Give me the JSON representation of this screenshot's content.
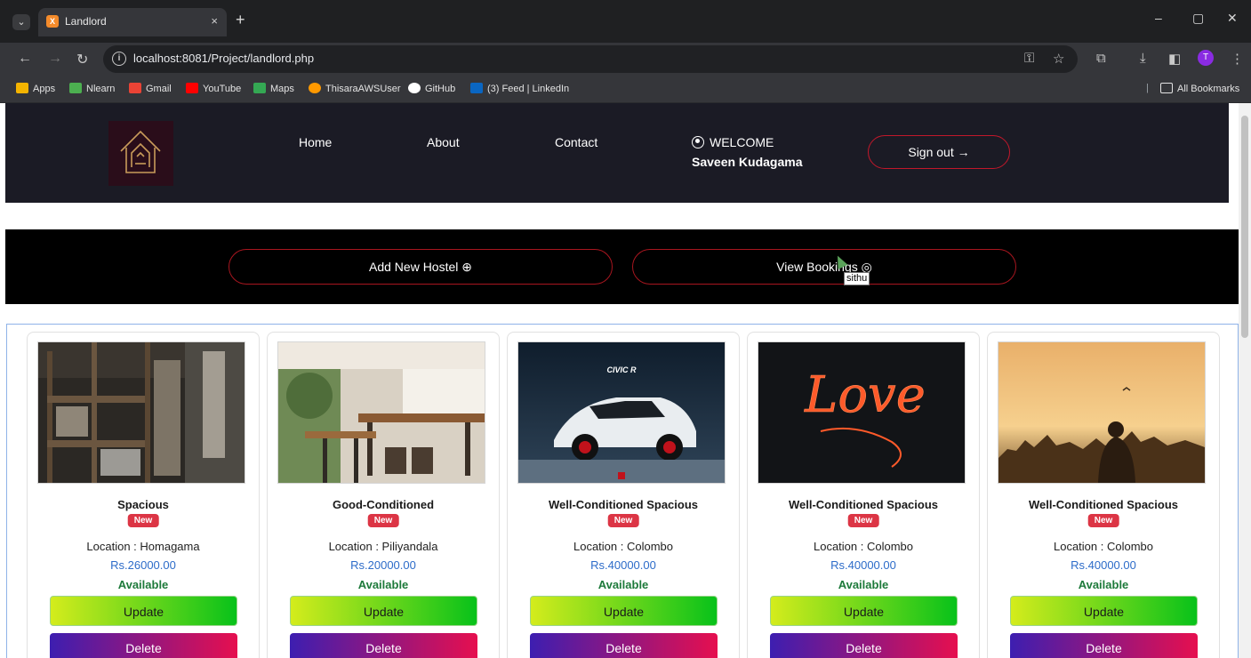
{
  "browser": {
    "tab": {
      "title": "Landlord",
      "close": "×",
      "new_tab": "+"
    },
    "window_controls": {
      "minimize": "–",
      "restore": "▢",
      "close": "✕"
    },
    "url": "localhost:8081/Project/landlord.php",
    "bookmarks": [
      {
        "label": "Apps",
        "icon": "apps-grid-icon",
        "color": "#f4b400"
      },
      {
        "label": "Nlearn",
        "icon": "nlearn-icon",
        "color": "#4caf50"
      },
      {
        "label": "Gmail",
        "icon": "gmail-icon",
        "color": "#ea4335"
      },
      {
        "label": "YouTube",
        "icon": "youtube-icon",
        "color": "#ff0000"
      },
      {
        "label": "Maps",
        "icon": "maps-icon",
        "color": "#34a853"
      },
      {
        "label": "ThisaraAWSUser",
        "icon": "aws-icon",
        "color": "#ff9900"
      },
      {
        "label": "GitHub",
        "icon": "github-icon",
        "color": "#ffffff"
      },
      {
        "label": "(3) Feed | LinkedIn",
        "icon": "linkedin-icon",
        "color": "#0a66c2"
      }
    ],
    "all_bookmarks": "All Bookmarks",
    "profile_initial": "T"
  },
  "header": {
    "nav": [
      "Home",
      "About",
      "Contact"
    ],
    "welcome": "WELCOME",
    "user_name": "Saveen Kudagama",
    "signout": "Sign out →"
  },
  "actions": {
    "add_hostel": "Add New Hostel ⊕",
    "view_bookings": "View Bookings ◎",
    "tooltip": "sithu"
  },
  "cards": [
    {
      "title": "Spacious",
      "badge": "New",
      "location": "Location : Homagama",
      "price": "Rs.26000.00",
      "status": "Available",
      "update": "Update",
      "delete": "Delete"
    },
    {
      "title": "Good-Conditioned",
      "badge": "New",
      "location": "Location : Piliyandala",
      "price": "Rs.20000.00",
      "status": "Available",
      "update": "Update",
      "delete": "Delete"
    },
    {
      "title": "Well-Conditioned Spacious",
      "badge": "New",
      "location": "Location : Colombo",
      "price": "Rs.40000.00",
      "status": "Available",
      "update": "Update",
      "delete": "Delete"
    },
    {
      "title": "Well-Conditioned Spacious",
      "badge": "New",
      "location": "Location : Colombo",
      "price": "Rs.40000.00",
      "status": "Available",
      "update": "Update",
      "delete": "Delete"
    },
    {
      "title": "Well-Conditioned Spacious",
      "badge": "New",
      "location": "Location : Colombo",
      "price": "Rs.40000.00",
      "status": "Available",
      "update": "Update",
      "delete": "Delete"
    }
  ],
  "image_art": {
    "love_sign": "Love",
    "car_label": "CIVIC R"
  }
}
